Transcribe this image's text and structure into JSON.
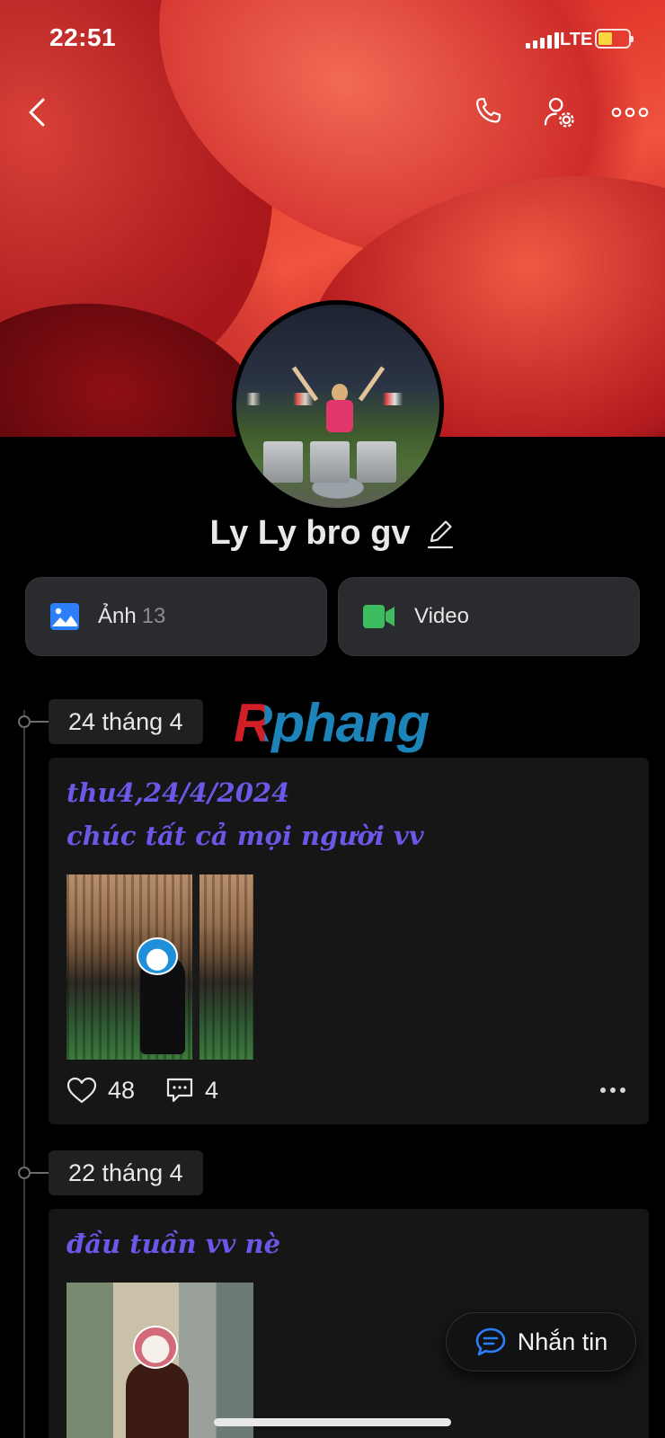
{
  "status_bar": {
    "time": "22:51",
    "network": "LTE",
    "battery_level": 0.35
  },
  "nav": {
    "back_icon": "chevron-left-icon",
    "call_icon": "phone-icon",
    "settings_icon": "user-settings-icon",
    "more_icon": "more-horizontal-icon"
  },
  "profile": {
    "name": "Ly Ly bro gv",
    "edit_icon": "pencil-icon"
  },
  "media": {
    "photos": {
      "label": "Ảnh",
      "count": "13",
      "icon": "image-icon",
      "color": "#2d7ff9"
    },
    "video": {
      "label": "Video",
      "icon": "video-camera-icon",
      "color": "#3dbb5f"
    }
  },
  "watermark": "Rphang",
  "posts": [
    {
      "date": "24 tháng 4",
      "caption_lines": [
        "thu4,24/4/2024",
        "chúc tất cả mọi người vv"
      ],
      "likes": "48",
      "comments": "4"
    },
    {
      "date": "22 tháng 4",
      "caption_lines": [
        "đầu tuần vv nè"
      ]
    }
  ],
  "fab": {
    "label": "Nhắn tin",
    "icon": "chat-bubble-icon"
  },
  "colors": {
    "accent": "#6a58e8",
    "background": "#000000",
    "card": "#161616"
  }
}
